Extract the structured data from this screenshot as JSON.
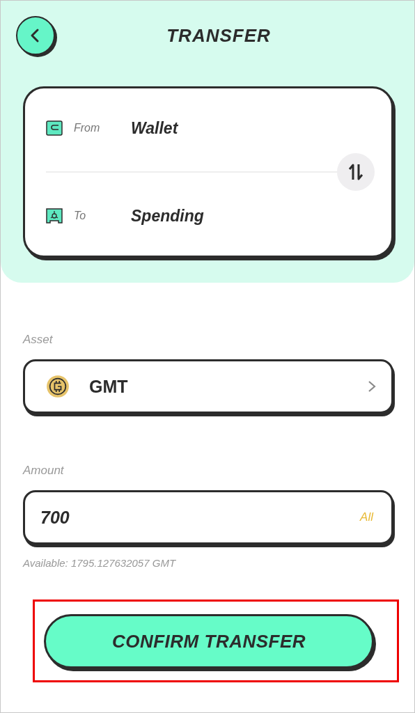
{
  "header": {
    "title": "TRANSFER"
  },
  "transfer": {
    "from": {
      "label": "From",
      "value": "Wallet"
    },
    "to": {
      "label": "To",
      "value": "Spending"
    }
  },
  "asset": {
    "label": "Asset",
    "value": "GMT"
  },
  "amount": {
    "label": "Amount",
    "value": "700",
    "all_link": "All",
    "available": "Available:  1795.127632057  GMT"
  },
  "confirm_button": {
    "label": "CONFIRM TRANSFER",
    "highlighted": true
  }
}
